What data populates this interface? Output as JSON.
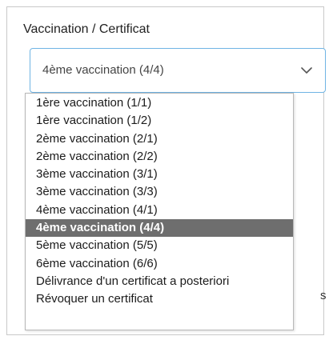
{
  "field": {
    "label": "Vaccination / Certificat",
    "selected_value": "4ème vaccination (4/4)",
    "chevron_icon": "chevron-down-icon"
  },
  "dropdown": {
    "options": [
      "1ère vaccination (1/1)",
      "1ère vaccination (1/2)",
      "2ème vaccination (2/1)",
      "2ème vaccination (2/2)",
      "3ème vaccination (3/1)",
      "3ème vaccination (3/3)",
      "4ème vaccination (4/1)",
      "4ème vaccination (4/4)",
      "5ème vaccination (5/5)",
      "6ème vaccination (6/6)",
      "Délivrance d'un certificat a posteriori",
      "Révoquer un certificat"
    ],
    "selected_index": 7
  },
  "colors": {
    "select_border": "#6fb4e4",
    "selected_option_bg": "#6e6e6e",
    "selected_option_text": "#ffffff"
  },
  "background_fragments": {
    "right_edge_char": "s"
  }
}
